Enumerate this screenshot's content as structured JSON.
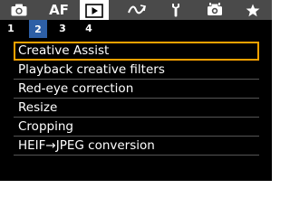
{
  "colors": {
    "tab_bar_bg": "#4a4a4a",
    "selected_subtab": "#2d5fa6",
    "selection_border": "#ffa200"
  },
  "tabs": [
    {
      "name": "shooting",
      "icon": "camera-icon",
      "label": ""
    },
    {
      "name": "af",
      "icon": "",
      "label": "AF"
    },
    {
      "name": "playback",
      "icon": "playback-icon",
      "label": "",
      "selected": true
    },
    {
      "name": "wireless",
      "icon": "wireless-icon",
      "label": ""
    },
    {
      "name": "setup",
      "icon": "wrench-icon",
      "label": ""
    },
    {
      "name": "custom-functions",
      "icon": "custom-functions-camera-icon",
      "label": ""
    },
    {
      "name": "my-menu",
      "icon": "star-icon",
      "label": ""
    }
  ],
  "subtabs": [
    "1",
    "2",
    "3",
    "4"
  ],
  "selected_subtab": "2",
  "menu": {
    "items": [
      "Creative Assist",
      "Playback creative filters",
      "Red-eye correction",
      "Resize",
      "Cropping",
      "HEIF→JPEG conversion"
    ],
    "selected_index": 0
  }
}
